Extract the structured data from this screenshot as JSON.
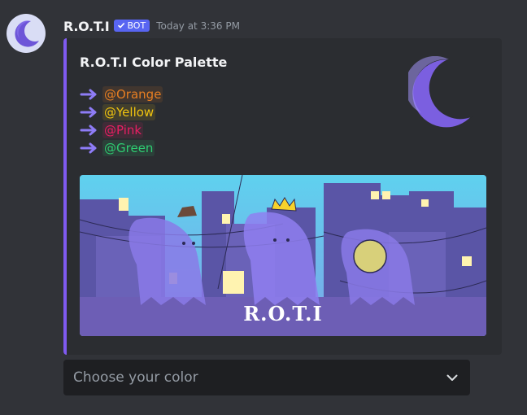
{
  "message": {
    "username": "R.O.T.I",
    "bot_tag": "BOT",
    "timestamp": "Today at 3:36 PM"
  },
  "embed": {
    "accent_color": "#7f5af0",
    "title": "R.O.T.I Color Palette",
    "roles": [
      {
        "label": "@Orange",
        "color": "#e67e22"
      },
      {
        "label": "@Yellow",
        "color": "#f1c40f"
      },
      {
        "label": "@Pink",
        "color": "#e91e63"
      },
      {
        "label": "@Green",
        "color": "#2ecc71"
      }
    ],
    "banner_text": "R.O.T.I"
  },
  "select_menu": {
    "placeholder": "Choose your color"
  },
  "colors": {
    "background": "#313338",
    "embed_background": "#2b2d31",
    "bot_tag": "#5865f2",
    "moon": "#7b5fe0"
  }
}
